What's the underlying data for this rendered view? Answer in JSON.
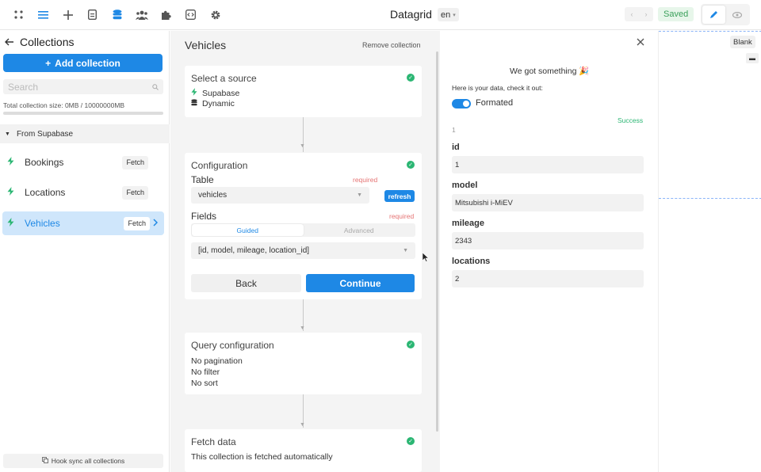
{
  "topbar": {
    "icons": [
      "grid-icon",
      "list-icon",
      "plus-icon",
      "page-icon",
      "database-icon",
      "users-icon",
      "puzzle-icon",
      "code-icon",
      "gear-icon"
    ],
    "app_title": "Datagrid",
    "lang": "en",
    "saved": "Saved"
  },
  "sidebar": {
    "title": "Collections",
    "add_label": "Add collection",
    "search_placeholder": "Search",
    "size_text": "Total collection size: 0MB / 10000000MB",
    "group_label": "From Supabase",
    "items": [
      {
        "name": "Bookings",
        "tag": "Fetch"
      },
      {
        "name": "Locations",
        "tag": "Fetch"
      },
      {
        "name": "Vehicles",
        "tag": "Fetch"
      }
    ],
    "hook_label": "Hook sync all collections"
  },
  "middle": {
    "title": "Vehicles",
    "remove_label": "Remove collection",
    "source": {
      "title": "Select a source",
      "opt1": "Supabase",
      "opt2": "Dynamic"
    },
    "config": {
      "title": "Configuration",
      "table_label": "Table",
      "required": "required",
      "table_value": "vehicles",
      "refresh": "refresh",
      "fields_label": "Fields",
      "tab_guided": "Guided",
      "tab_advanced": "Advanced",
      "fields_value": "[id, model, mileage, location_id]",
      "back": "Back",
      "continue": "Continue"
    },
    "query": {
      "title": "Query configuration",
      "l1": "No pagination",
      "l2": "No filter",
      "l3": "No sort"
    },
    "fetch": {
      "title": "Fetch data",
      "l1": "This collection is fetched automatically"
    }
  },
  "result": {
    "headline": "We got something 🎉",
    "sub": "Here is your data, check it out:",
    "toggle_label": "Formated",
    "success": "Success",
    "index": "1",
    "fields": [
      {
        "key": "id",
        "value": "1"
      },
      {
        "key": "model",
        "value": "Mitsubishi i-MiEV"
      },
      {
        "key": "mileage",
        "value": "2343"
      },
      {
        "key": "locations",
        "value": "2"
      }
    ]
  },
  "canvas": {
    "blank": "Blank"
  },
  "colors": {
    "accent": "#1e88e5",
    "success": "#2bb673",
    "required": "#e57373"
  }
}
